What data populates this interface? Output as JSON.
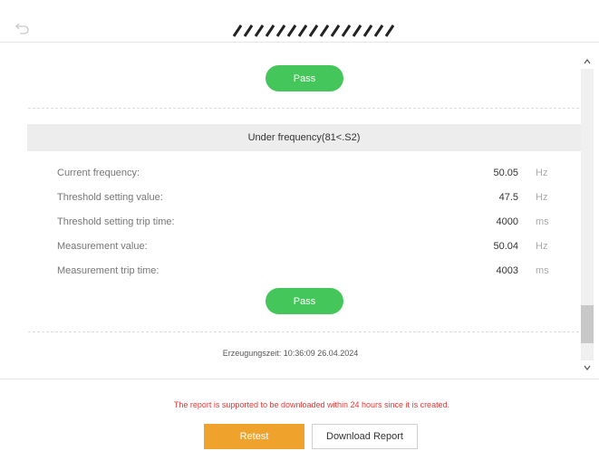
{
  "header": {
    "back_icon": "back-arrow-icon",
    "logo": "redacted-title-logo"
  },
  "top_result": {
    "label": "Pass"
  },
  "section": {
    "title": "Under frequency(81<.S2)",
    "rows": [
      {
        "label": "Current frequency:",
        "value": "50.05",
        "unit": "Hz"
      },
      {
        "label": "Threshold setting value:",
        "value": "47.5",
        "unit": "Hz"
      },
      {
        "label": "Threshold setting trip time:",
        "value": "4000",
        "unit": "ms"
      },
      {
        "label": "Measurement value:",
        "value": "50.04",
        "unit": "Hz"
      },
      {
        "label": "Measurement trip time:",
        "value": "4003",
        "unit": "ms"
      }
    ],
    "result": {
      "label": "Pass"
    }
  },
  "generation_time": "Erzeugungszeit: 10:36:09 26.04.2024",
  "scrollbar": {
    "up": "^",
    "down": "v"
  },
  "footer": {
    "notice": "The report is supported to be downloaded within 24 hours since it is created.",
    "retest_label": "Retest",
    "download_label": "Download Report"
  },
  "colors": {
    "pass": "#45c65a",
    "retest": "#f0a32c",
    "notice": "#e53935"
  }
}
